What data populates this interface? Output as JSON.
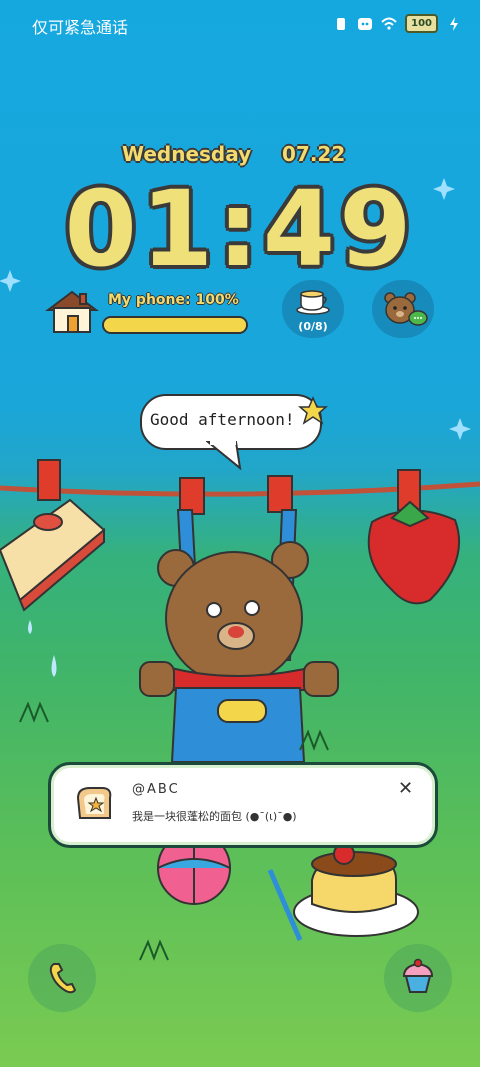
{
  "status_bar": {
    "left_text": "仅可紧急通话",
    "battery": "100"
  },
  "clock": {
    "weekday": "Wednesday",
    "date": "07.22",
    "time": "01:49"
  },
  "phone_status": {
    "label": "My phone: 100%",
    "level_fraction": 1.0
  },
  "water_widget": {
    "count": "(0/8)"
  },
  "speech_bubble": {
    "text": "Good afternoon!"
  },
  "notification": {
    "title": "@ABC",
    "body": "我是一块很蓬松的面包 (●¯(ι)¯●)",
    "close_symbol": "✕"
  },
  "icons": {
    "left_shortcut": "phone-icon",
    "right_shortcut": "cupcake-icon"
  },
  "colors": {
    "clock_yellow": "#efe07a",
    "outline": "#3a3a3a",
    "sky": "#15a8df",
    "grass": "#5cbf58"
  }
}
